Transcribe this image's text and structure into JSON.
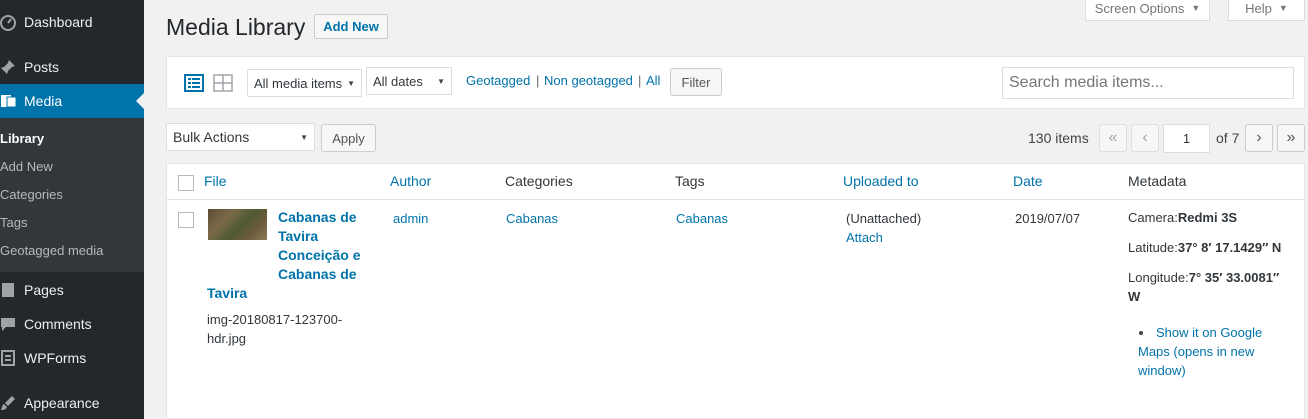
{
  "sidebar": {
    "items": [
      {
        "label": "Dashboard",
        "icon": "dashboard-icon"
      },
      {
        "label": "Posts",
        "icon": "pin-icon"
      },
      {
        "label": "Media",
        "icon": "media-icon"
      },
      {
        "label": "Pages",
        "icon": "page-icon"
      },
      {
        "label": "Comments",
        "icon": "comment-icon"
      },
      {
        "label": "WPForms",
        "icon": "form-icon"
      },
      {
        "label": "Appearance",
        "icon": "brush-icon"
      }
    ],
    "submenu": [
      "Library",
      "Add New",
      "Categories",
      "Tags",
      "Geotagged media"
    ],
    "active_color": "#0073aa"
  },
  "screen_meta": {
    "screen_options": "Screen Options",
    "help": "Help"
  },
  "header": {
    "title": "Media Library",
    "add_new": "Add New"
  },
  "filters": {
    "media_type": "All media items",
    "dates": "All dates",
    "geotagged": "Geotagged",
    "non_geotagged": "Non geotagged",
    "all": "All",
    "separator": "|",
    "filter_button": "Filter",
    "search_placeholder": "Search media items..."
  },
  "bulk": {
    "action": "Bulk Actions",
    "apply": "Apply"
  },
  "pagination": {
    "count": "130 items",
    "first": "«",
    "prev": "‹",
    "current_page": "1",
    "of": "of 7",
    "next": "›",
    "last": "»"
  },
  "table": {
    "columns": [
      "File",
      "Author",
      "Categories",
      "Tags",
      "Uploaded to",
      "Date",
      "Metadata"
    ],
    "rows": [
      {
        "title_lines": [
          "Cabanas de",
          "Tavira",
          "Conceição e",
          "Cabanas de",
          "Tavira"
        ],
        "filename_lines": [
          "img-20180817-123700-",
          "hdr.jpg"
        ],
        "author": "admin",
        "category": "Cabanas",
        "tag": "Cabanas",
        "uploaded_to": "(Unattached)",
        "attach": "Attach",
        "date": "2019/07/07",
        "camera_label": "Camera:",
        "camera_value": "Redmi 3S",
        "latitude_label": "Latitude:",
        "latitude_value": "37° 8′ 17.1429″ N",
        "longitude_label": "Longitude:",
        "longitude_value_1": "7° 35′ 33.0081″",
        "longitude_value_2": "W",
        "maps_link_lines": [
          "Show it on Google",
          "Maps (opens in new",
          "window)"
        ]
      }
    ]
  }
}
